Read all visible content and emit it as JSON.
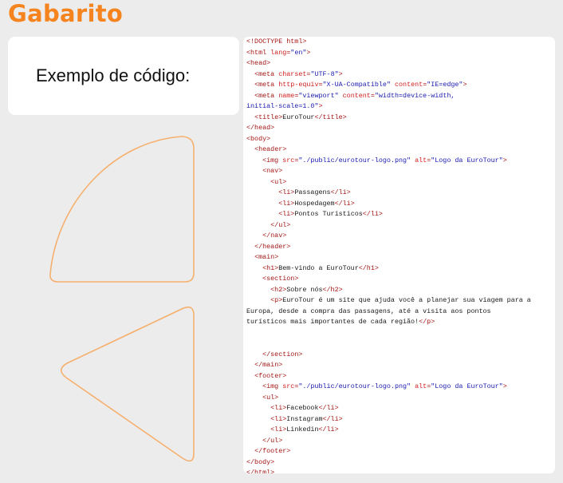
{
  "header": {
    "title": "Gabarito"
  },
  "left_card": {
    "label": "Exemplo de código:"
  },
  "decor": {
    "stroke_color": "#f6b06e",
    "shapes": [
      "quarter-circle-shape",
      "triangle-shape"
    ]
  },
  "colors": {
    "title": "#f5841f",
    "background": "#ececec",
    "tag": "#a31515",
    "attr": "#d11e1e",
    "value": "#1a1ab0"
  },
  "code": {
    "lines": [
      [
        {
          "t": "tag",
          "s": "<!DOCTYPE html>"
        }
      ],
      [
        {
          "t": "tag",
          "s": "<html "
        },
        {
          "t": "attr",
          "s": "lang"
        },
        {
          "t": "tag",
          "s": "="
        },
        {
          "t": "val",
          "s": "\"en\""
        },
        {
          "t": "tag",
          "s": ">"
        }
      ],
      [
        {
          "t": "tag",
          "s": "<head>"
        }
      ],
      [
        {
          "t": "txt",
          "s": "  "
        },
        {
          "t": "tag",
          "s": "<meta "
        },
        {
          "t": "attr",
          "s": "charset"
        },
        {
          "t": "tag",
          "s": "="
        },
        {
          "t": "val",
          "s": "\"UTF-8\""
        },
        {
          "t": "tag",
          "s": ">"
        }
      ],
      [
        {
          "t": "txt",
          "s": "  "
        },
        {
          "t": "tag",
          "s": "<meta "
        },
        {
          "t": "attr",
          "s": "http-equiv"
        },
        {
          "t": "tag",
          "s": "="
        },
        {
          "t": "val",
          "s": "\"X-UA-Compatible\""
        },
        {
          "t": "tag",
          "s": " "
        },
        {
          "t": "attr",
          "s": "content"
        },
        {
          "t": "tag",
          "s": "="
        },
        {
          "t": "val",
          "s": "\"IE=edge\""
        },
        {
          "t": "tag",
          "s": ">"
        }
      ],
      [
        {
          "t": "txt",
          "s": "  "
        },
        {
          "t": "tag",
          "s": "<meta "
        },
        {
          "t": "attr",
          "s": "name"
        },
        {
          "t": "tag",
          "s": "="
        },
        {
          "t": "val",
          "s": "\"viewport\""
        },
        {
          "t": "tag",
          "s": " "
        },
        {
          "t": "attr",
          "s": "content"
        },
        {
          "t": "tag",
          "s": "="
        },
        {
          "t": "val",
          "s": "\"width=device-width,"
        }
      ],
      [
        {
          "t": "val",
          "s": "initial-scale=1.0\""
        },
        {
          "t": "tag",
          "s": ">"
        }
      ],
      [
        {
          "t": "txt",
          "s": "  "
        },
        {
          "t": "tag",
          "s": "<title>"
        },
        {
          "t": "txt",
          "s": "EuroTour"
        },
        {
          "t": "tag",
          "s": "</title>"
        }
      ],
      [
        {
          "t": "tag",
          "s": "</head>"
        }
      ],
      [
        {
          "t": "tag",
          "s": "<body>"
        }
      ],
      [
        {
          "t": "txt",
          "s": "  "
        },
        {
          "t": "tag",
          "s": "<header>"
        }
      ],
      [
        {
          "t": "txt",
          "s": "    "
        },
        {
          "t": "tag",
          "s": "<img "
        },
        {
          "t": "attr",
          "s": "src"
        },
        {
          "t": "tag",
          "s": "="
        },
        {
          "t": "val",
          "s": "\"./public/eurotour-logo.png\""
        },
        {
          "t": "tag",
          "s": " "
        },
        {
          "t": "attr",
          "s": "alt"
        },
        {
          "t": "tag",
          "s": "="
        },
        {
          "t": "val",
          "s": "\"Logo da EuroTour\""
        },
        {
          "t": "tag",
          "s": ">"
        }
      ],
      [
        {
          "t": "txt",
          "s": "    "
        },
        {
          "t": "tag",
          "s": "<nav>"
        }
      ],
      [
        {
          "t": "txt",
          "s": "      "
        },
        {
          "t": "tag",
          "s": "<ul>"
        }
      ],
      [
        {
          "t": "txt",
          "s": "        "
        },
        {
          "t": "tag",
          "s": "<li>"
        },
        {
          "t": "txt",
          "s": "Passagens"
        },
        {
          "t": "tag",
          "s": "</li>"
        }
      ],
      [
        {
          "t": "txt",
          "s": "        "
        },
        {
          "t": "tag",
          "s": "<li>"
        },
        {
          "t": "txt",
          "s": "Hospedagem"
        },
        {
          "t": "tag",
          "s": "</li>"
        }
      ],
      [
        {
          "t": "txt",
          "s": "        "
        },
        {
          "t": "tag",
          "s": "<li>"
        },
        {
          "t": "txt",
          "s": "Pontos Turísticos"
        },
        {
          "t": "tag",
          "s": "</li>"
        }
      ],
      [
        {
          "t": "txt",
          "s": "      "
        },
        {
          "t": "tag",
          "s": "</ul>"
        }
      ],
      [
        {
          "t": "txt",
          "s": "    "
        },
        {
          "t": "tag",
          "s": "</nav>"
        }
      ],
      [
        {
          "t": "txt",
          "s": "  "
        },
        {
          "t": "tag",
          "s": "</header>"
        }
      ],
      [
        {
          "t": "txt",
          "s": "  "
        },
        {
          "t": "tag",
          "s": "<main>"
        }
      ],
      [
        {
          "t": "txt",
          "s": "    "
        },
        {
          "t": "tag",
          "s": "<h1>"
        },
        {
          "t": "txt",
          "s": "Bem-vindo a EuroTour"
        },
        {
          "t": "tag",
          "s": "</h1>"
        }
      ],
      [
        {
          "t": "txt",
          "s": "    "
        },
        {
          "t": "tag",
          "s": "<section>"
        }
      ],
      [
        {
          "t": "txt",
          "s": "      "
        },
        {
          "t": "tag",
          "s": "<h2>"
        },
        {
          "t": "txt",
          "s": "Sobre nós"
        },
        {
          "t": "tag",
          "s": "</h2>"
        }
      ],
      [
        {
          "t": "txt",
          "s": "      "
        },
        {
          "t": "tag",
          "s": "<p>"
        },
        {
          "t": "txt",
          "s": "EuroTour é um site que ajuda você a planejar sua viagem para a"
        }
      ],
      [
        {
          "t": "txt",
          "s": "Europa, desde a compra das passagens, até a visita aos pontos"
        }
      ],
      [
        {
          "t": "txt",
          "s": "turísticos mais importantes de cada região!"
        },
        {
          "t": "tag",
          "s": "</p>"
        }
      ],
      [
        {
          "t": "txt",
          "s": ""
        }
      ],
      [
        {
          "t": "txt",
          "s": ""
        }
      ],
      [
        {
          "t": "txt",
          "s": "    "
        },
        {
          "t": "tag",
          "s": "</section>"
        }
      ],
      [
        {
          "t": "txt",
          "s": "  "
        },
        {
          "t": "tag",
          "s": "</main>"
        }
      ],
      [
        {
          "t": "txt",
          "s": "  "
        },
        {
          "t": "tag",
          "s": "<footer>"
        }
      ],
      [
        {
          "t": "txt",
          "s": "    "
        },
        {
          "t": "tag",
          "s": "<img "
        },
        {
          "t": "attr",
          "s": "src"
        },
        {
          "t": "tag",
          "s": "="
        },
        {
          "t": "val",
          "s": "\"./public/eurotour-logo.png\""
        },
        {
          "t": "tag",
          "s": " "
        },
        {
          "t": "attr",
          "s": "alt"
        },
        {
          "t": "tag",
          "s": "="
        },
        {
          "t": "val",
          "s": "\"Logo da EuroTour\""
        },
        {
          "t": "tag",
          "s": ">"
        }
      ],
      [
        {
          "t": "txt",
          "s": "    "
        },
        {
          "t": "tag",
          "s": "<ul>"
        }
      ],
      [
        {
          "t": "txt",
          "s": "      "
        },
        {
          "t": "tag",
          "s": "<li>"
        },
        {
          "t": "txt",
          "s": "Facebook"
        },
        {
          "t": "tag",
          "s": "</li>"
        }
      ],
      [
        {
          "t": "txt",
          "s": "      "
        },
        {
          "t": "tag",
          "s": "<li>"
        },
        {
          "t": "txt",
          "s": "Instagram"
        },
        {
          "t": "tag",
          "s": "</li>"
        }
      ],
      [
        {
          "t": "txt",
          "s": "      "
        },
        {
          "t": "tag",
          "s": "<li>"
        },
        {
          "t": "txt",
          "s": "Linkedin"
        },
        {
          "t": "tag",
          "s": "</li>"
        }
      ],
      [
        {
          "t": "txt",
          "s": "    "
        },
        {
          "t": "tag",
          "s": "</ul>"
        }
      ],
      [
        {
          "t": "txt",
          "s": "  "
        },
        {
          "t": "tag",
          "s": "</footer>"
        }
      ],
      [
        {
          "t": "tag",
          "s": "</body>"
        }
      ],
      [
        {
          "t": "tag",
          "s": "</html>"
        }
      ]
    ]
  }
}
